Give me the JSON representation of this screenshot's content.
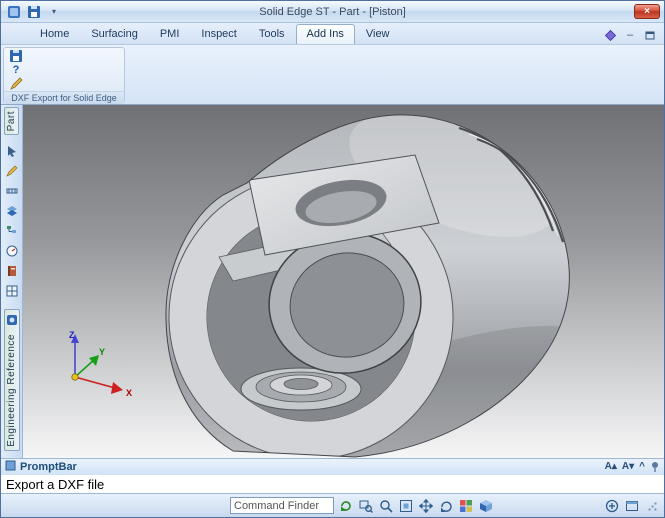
{
  "window": {
    "title": "Solid Edge ST - Part - [Piston]"
  },
  "ribbon": {
    "tabs": [
      "Home",
      "Surfacing",
      "PMI",
      "Inspect",
      "Tools",
      "Add Ins",
      "View"
    ],
    "active_tab": "Add Ins",
    "group_label": "DXF Export for Solid Edge"
  },
  "sidebar": {
    "top_tab_label": "Part",
    "bottom_tab_label": "Engineering Reference"
  },
  "viewport": {
    "axes": {
      "x": "X",
      "y": "Y",
      "z": "Z"
    }
  },
  "prompt_bar": {
    "label": "PromptBar",
    "message": "Export a DXF file"
  },
  "status_bar": {
    "command_finder_placeholder": "Command Finder"
  },
  "glyphs": {
    "close": "×",
    "qat_dropdown": "▾",
    "ribbon_minimize": "–",
    "help_question": "?",
    "font_increase": "A▴",
    "font_decrease": "A▾",
    "collapse": "^"
  },
  "colors": {
    "ribbon_blue": "#dce9f8",
    "prompt_label_blue": "#1f4e79",
    "close_red": "#d5503c",
    "axis_x_red": "#cf2020",
    "axis_y_green": "#15a015",
    "axis_z_blue": "#4646cf",
    "origin_yellow": "#e7c31f"
  },
  "icons": {
    "app-icon": "solid-edge-blue-square",
    "save-icon": "floppy-disk",
    "help-diamond-icon": "blue-diamond",
    "dxf-save-icon": "floppy-disk",
    "dxf-help-icon": "question-mark",
    "dxf-export-icon": "yellow-pencil",
    "pin-icon": "pushpin",
    "refresh-icon": "green-circular-arrow",
    "zoom-icon": "magnifier",
    "zoom-area-icon": "magnifier-over-rectangle",
    "fit-icon": "fit-rectangle",
    "pan-icon": "four-way-arrows",
    "rotate-icon": "circular-arrow",
    "view-styles-icon": "color-grid",
    "shaded-cube-icon": "isometric-cube",
    "zoom-in-icon": "circle-plus",
    "resize-grip": "corner-dots"
  }
}
